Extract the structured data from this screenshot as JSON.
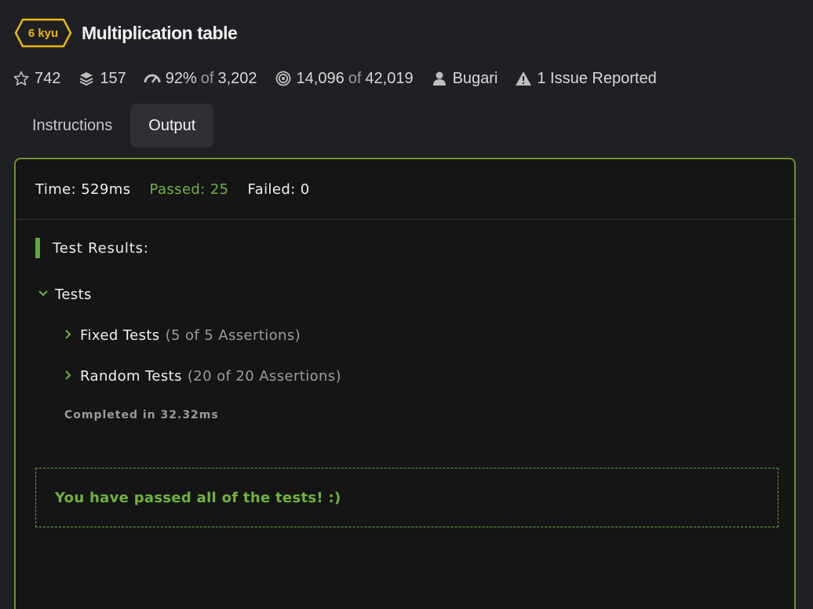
{
  "header": {
    "kyu": "6 kyu",
    "title": "Multiplication table"
  },
  "stats": {
    "stars": "742",
    "collections": "157",
    "satisfaction_pct": "92%",
    "satisfaction_of": "of",
    "satisfaction_total": "3,202",
    "completions": "14,096",
    "completions_of": "of",
    "attempts": "42,019",
    "author": "Bugari",
    "issues": "1 Issue Reported"
  },
  "tabs": [
    {
      "label": "Instructions",
      "active": false
    },
    {
      "label": "Output",
      "active": true
    }
  ],
  "output": {
    "time": "Time: 529ms",
    "passed": "Passed: 25",
    "failed": "Failed: 0",
    "results_heading": "Test Results:",
    "tests_group": "Tests",
    "fixed_label": "Fixed Tests",
    "fixed_count": "(5 of 5 Assertions)",
    "random_label": "Random Tests",
    "random_count": "(20 of 20 Assertions)",
    "completed": "Completed in 32.32ms",
    "pass_message": "You have passed all of the tests! :)"
  },
  "colors": {
    "accent_green": "#6fb33c",
    "kyu_yellow": "#ecb613",
    "panel_border": "#6f8f2e"
  },
  "icons": [
    "star-icon",
    "collections-icon",
    "satisfaction-icon",
    "target-icon",
    "user-icon",
    "warning-icon",
    "chevron-down-icon",
    "chevron-right-icon"
  ]
}
